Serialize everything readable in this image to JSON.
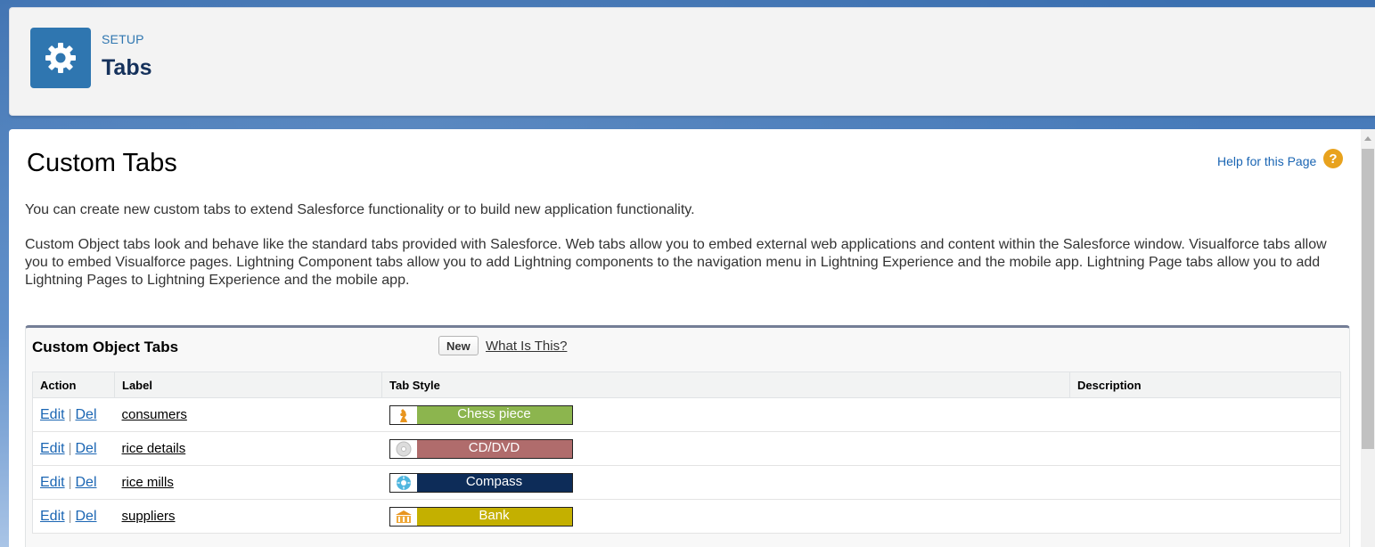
{
  "header": {
    "eyebrow": "SETUP",
    "title": "Tabs",
    "icon": "gear-icon",
    "icon_color": "#2f76b0"
  },
  "page": {
    "title": "Custom Tabs",
    "help_link": "Help for this Page",
    "intro": "You can create new custom tabs to extend Salesforce functionality or to build new application functionality.",
    "description": "Custom Object tabs look and behave like the standard tabs provided with Salesforce. Web tabs allow you to embed external web applications and content within the Salesforce window. Visualforce tabs allow you to embed Visualforce pages. Lightning Component tabs allow you to add Lightning components to the navigation menu in Lightning Experience and the mobile app. Lightning Page tabs allow you to add Lightning Pages to Lightning Experience and the mobile app."
  },
  "panel": {
    "title": "Custom Object Tabs",
    "new_label": "New",
    "what_label": "What Is This?",
    "columns": [
      "Action",
      "Label",
      "Tab Style",
      "Description"
    ],
    "rows": [
      {
        "edit": "Edit",
        "sep": "|",
        "del": "Del",
        "label": "consumers",
        "style": "Chess piece",
        "style_color": "#8cb54e",
        "style_icon": "chess-piece-icon",
        "description": ""
      },
      {
        "edit": "Edit",
        "sep": "|",
        "del": "Del",
        "label": "rice details",
        "style": "CD/DVD",
        "style_color": "#b06c6c",
        "style_icon": "cd-dvd-icon",
        "description": ""
      },
      {
        "edit": "Edit",
        "sep": "|",
        "del": "Del",
        "label": "rice mills",
        "style": "Compass",
        "style_color": "#0d2c58",
        "style_icon": "compass-icon",
        "description": ""
      },
      {
        "edit": "Edit",
        "sep": "|",
        "del": "Del",
        "label": "suppliers",
        "style": "Bank",
        "style_color": "#c4b000",
        "style_icon": "bank-icon",
        "description": ""
      }
    ]
  }
}
